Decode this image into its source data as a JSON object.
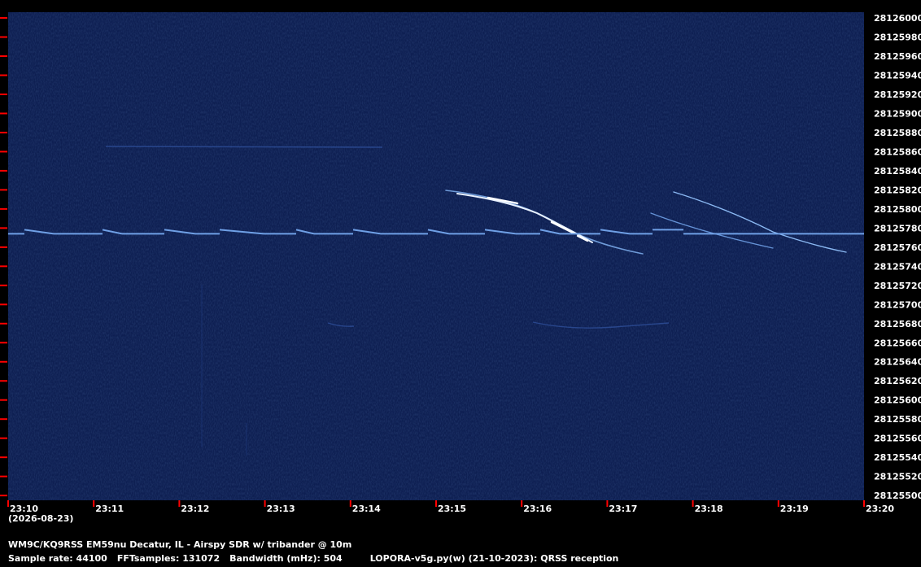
{
  "chart_data": {
    "type": "heatmap",
    "date": "(2026-08-23)",
    "time_ticks": [
      "23:10",
      "23:11",
      "23:12",
      "23:13",
      "23:14",
      "23:15",
      "23:16",
      "23:17",
      "23:18",
      "23:19",
      "23:20"
    ],
    "freq_ticks": [
      "28126000",
      "28125980",
      "28125960",
      "28125940",
      "28125920",
      "28125900",
      "28125880",
      "28125860",
      "28125840",
      "28125820",
      "28125800",
      "28125780",
      "28125760",
      "28125740",
      "28125720",
      "28125700",
      "28125680",
      "28125660",
      "28125640",
      "28125620",
      "28125600",
      "28125580",
      "28125560",
      "28125540",
      "28125520",
      "28125500"
    ],
    "ylim": [
      28125495,
      28126006
    ],
    "carrier_freq": 28125774,
    "colors": {
      "background": "#0e1f52",
      "signal": "#6fa0e6",
      "tick": "#ff0000"
    }
  },
  "title": "WM9C/KQ9RSS EM59nu Decatur, IL - Airspy SDR w/ tribander @ 10m",
  "sample_rate": "Sample rate: 44100",
  "fft_samples": "FFTsamples: 131072",
  "bandwidth": "Bandwidth (mHz): 504",
  "software": "LOPORA-v5g.py(w) (21-10-2023): QRSS reception"
}
